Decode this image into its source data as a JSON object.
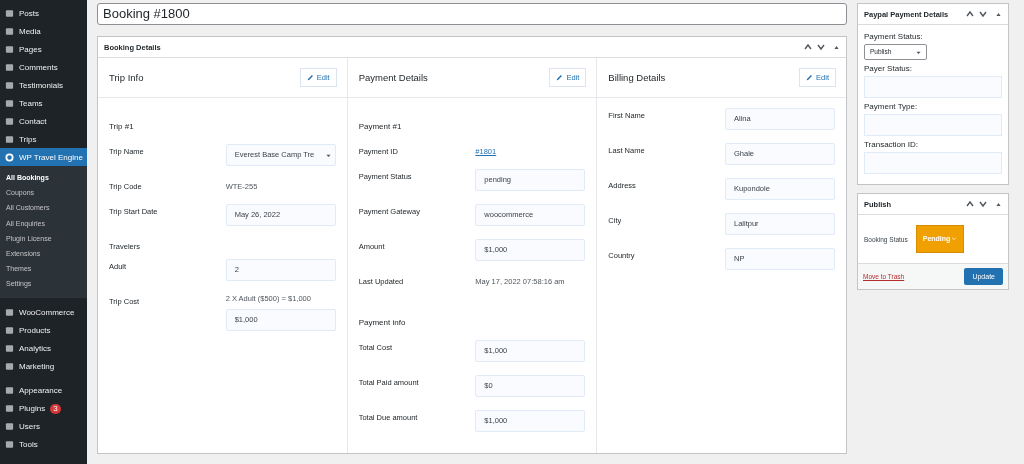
{
  "sidebar": {
    "items": [
      {
        "label": "Posts",
        "selected": false
      },
      {
        "label": "Media",
        "selected": false
      },
      {
        "label": "Pages",
        "selected": false
      },
      {
        "label": "Comments",
        "selected": false
      },
      {
        "label": "Testimonials",
        "selected": false
      },
      {
        "label": "Teams",
        "selected": false
      },
      {
        "label": "Contact",
        "selected": false
      },
      {
        "label": "Trips",
        "selected": false
      },
      {
        "label": "WP Travel Engine",
        "selected": true,
        "children": [
          {
            "label": "All Bookings",
            "selected": true
          },
          {
            "label": "Coupons",
            "selected": false
          },
          {
            "label": "All Customers",
            "selected": false
          },
          {
            "label": "All Enquiries",
            "selected": false
          },
          {
            "label": "Plugin License",
            "selected": false
          },
          {
            "label": "Extensions",
            "selected": false
          },
          {
            "label": "Themes",
            "selected": false
          },
          {
            "label": "Settings",
            "selected": false
          }
        ]
      },
      {
        "label": "WooCommerce",
        "selected": false
      },
      {
        "label": "Products",
        "selected": false
      },
      {
        "label": "Analytics",
        "selected": false
      },
      {
        "label": "Marketing",
        "selected": false
      },
      {
        "label": "Appearance",
        "selected": false
      },
      {
        "label": "Plugins",
        "selected": false,
        "badge": "3"
      },
      {
        "label": "Users",
        "selected": false
      },
      {
        "label": "Tools",
        "selected": false
      }
    ]
  },
  "title_field": {
    "value": "Booking #1800"
  },
  "booking_details": {
    "title": "Booking Details",
    "columns": [
      {
        "title": "Trip Info",
        "edit": "Edit",
        "rows": [
          {
            "kind": "heading",
            "label": "Trip #1"
          },
          {
            "kind": "select",
            "label": "Trip Name",
            "value": "Everest Base Camp Tre"
          },
          {
            "kind": "text",
            "label": "Trip Code",
            "value": "WTE-255"
          },
          {
            "kind": "field",
            "label": "Trip Start Date",
            "value": "May 26, 2022"
          },
          {
            "kind": "label",
            "label": "Travelers"
          },
          {
            "kind": "field",
            "label": "Adult",
            "value": "2"
          },
          {
            "kind": "field",
            "label": "Trip Cost",
            "note": "2 X Adult ($500) = $1,000",
            "value": "$1,000"
          }
        ]
      },
      {
        "title": "Payment Details",
        "edit": "Edit",
        "rows": [
          {
            "kind": "heading",
            "label": "Payment #1"
          },
          {
            "kind": "link",
            "label": "Payment ID",
            "value": "#1801"
          },
          {
            "kind": "field",
            "label": "Payment Status",
            "value": "pending"
          },
          {
            "kind": "field",
            "label": "Payment Gateway",
            "value": "woocommerce"
          },
          {
            "kind": "field",
            "label": "Amount",
            "value": "$1,000"
          },
          {
            "kind": "text",
            "label": "Last Updated",
            "value": "May 17, 2022 07:58:16 am"
          },
          {
            "kind": "heading",
            "label": "Payment info"
          },
          {
            "kind": "field",
            "label": "Total Cost",
            "value": "$1,000"
          },
          {
            "kind": "field",
            "label": "Total Paid amount",
            "value": "$0"
          },
          {
            "kind": "field",
            "label": "Total Due amount",
            "value": "$1,000"
          }
        ]
      },
      {
        "title": "Billing Details",
        "edit": "Edit",
        "rows": [
          {
            "kind": "field",
            "label": "First Name",
            "value": "Alina"
          },
          {
            "kind": "field",
            "label": "Last Name",
            "value": "Ghale"
          },
          {
            "kind": "field",
            "label": "Address",
            "value": "Kupondole"
          },
          {
            "kind": "field",
            "label": "City",
            "value": "Lalitpur"
          },
          {
            "kind": "field",
            "label": "Country",
            "value": "NP"
          }
        ]
      }
    ]
  },
  "paypal_box": {
    "title": "Paypal Payment Details",
    "fields": [
      {
        "kind": "select",
        "label": "Payment Status:",
        "value": "Publish"
      },
      {
        "kind": "input",
        "label": "Payer Status:"
      },
      {
        "kind": "input",
        "label": "Payment Type:"
      },
      {
        "kind": "input",
        "label": "Transaction ID:"
      }
    ]
  },
  "publish_box": {
    "title": "Publish",
    "status_label": "Booking Status",
    "status": "Pending",
    "trash_link": "Move to Trash",
    "update_button": "Update"
  }
}
